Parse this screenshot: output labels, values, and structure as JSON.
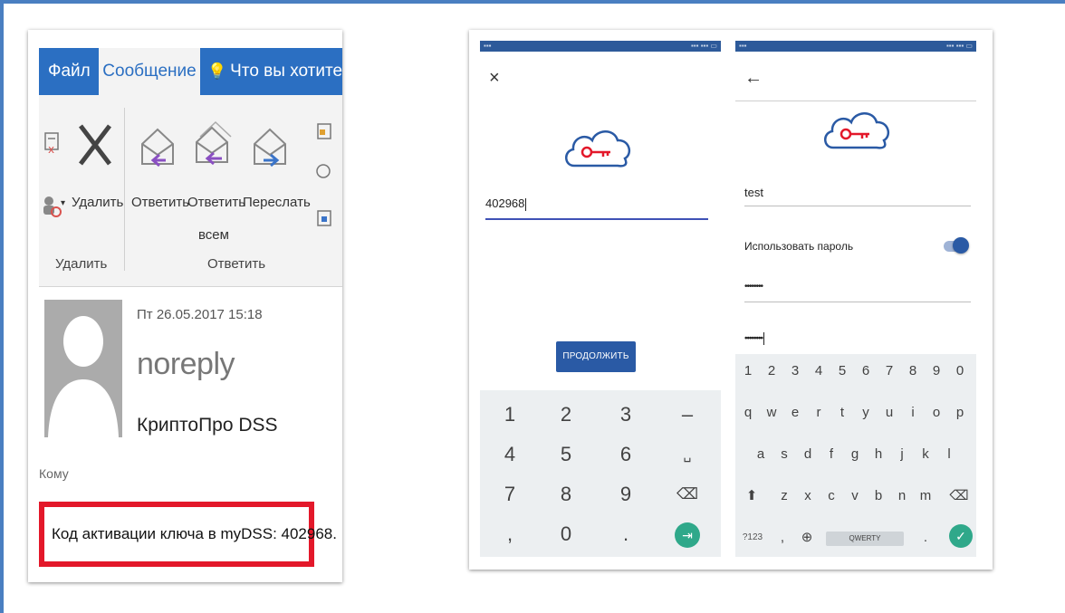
{
  "outlook": {
    "tabs": {
      "file": "Файл",
      "message": "Сообщение",
      "tell": "Что вы хотите сдел"
    },
    "ribbon": {
      "delete_label": "Удалить",
      "reply_label": "Ответить",
      "reply_all_label_1": "Ответить",
      "reply_all_label_2": "всем",
      "forward_label": "Переслать",
      "group_delete": "Удалить",
      "group_respond": "Ответить"
    },
    "mail": {
      "date": "Пт 26.05.2017 15:18",
      "from": "noreply",
      "organization": "КриптоПро DSS",
      "to_label": "Кому",
      "body_highlight": "Код активации ключа в myDSS: 402968."
    }
  },
  "phone_a": {
    "close_glyph": "×",
    "code_value": "402968",
    "continue_label": "ПРОДОЛЖИТЬ",
    "numpad": [
      [
        "1",
        "2",
        "3",
        "–"
      ],
      [
        "4",
        "5",
        "6",
        "␣"
      ],
      [
        "7",
        "8",
        "9",
        "⌫"
      ],
      [
        ",",
        "0",
        ".",
        "⇥"
      ]
    ]
  },
  "phone_b": {
    "back_glyph": "←",
    "login_value": "test",
    "use_password_label": "Использовать пароль",
    "use_password_on": true,
    "password_value": "••••••••",
    "password_confirm_value": "••••••••",
    "keyboard": {
      "row_digits": [
        "1",
        "2",
        "3",
        "4",
        "5",
        "6",
        "7",
        "8",
        "9",
        "0"
      ],
      "row1": [
        "q",
        "w",
        "e",
        "r",
        "t",
        "y",
        "u",
        "i",
        "o",
        "p"
      ],
      "row2": [
        "a",
        "s",
        "d",
        "f",
        "g",
        "h",
        "j",
        "k",
        "l"
      ],
      "row3": [
        "z",
        "x",
        "c",
        "v",
        "b",
        "n",
        "m"
      ],
      "shift": "⬆",
      "backspace": "⌫",
      "sym_label": "?123",
      "comma": ",",
      "globe": "⊕",
      "space_label": "QWERTY",
      "period": ".",
      "enter": "✓"
    }
  },
  "colors": {
    "frame": "#4a7fc1",
    "ribbon_blue": "#2b6fc2",
    "highlight_red": "#e3182a",
    "button_blue": "#2a5aa5",
    "accent_green": "#2fa88a",
    "input_active": "#3f51b5"
  }
}
